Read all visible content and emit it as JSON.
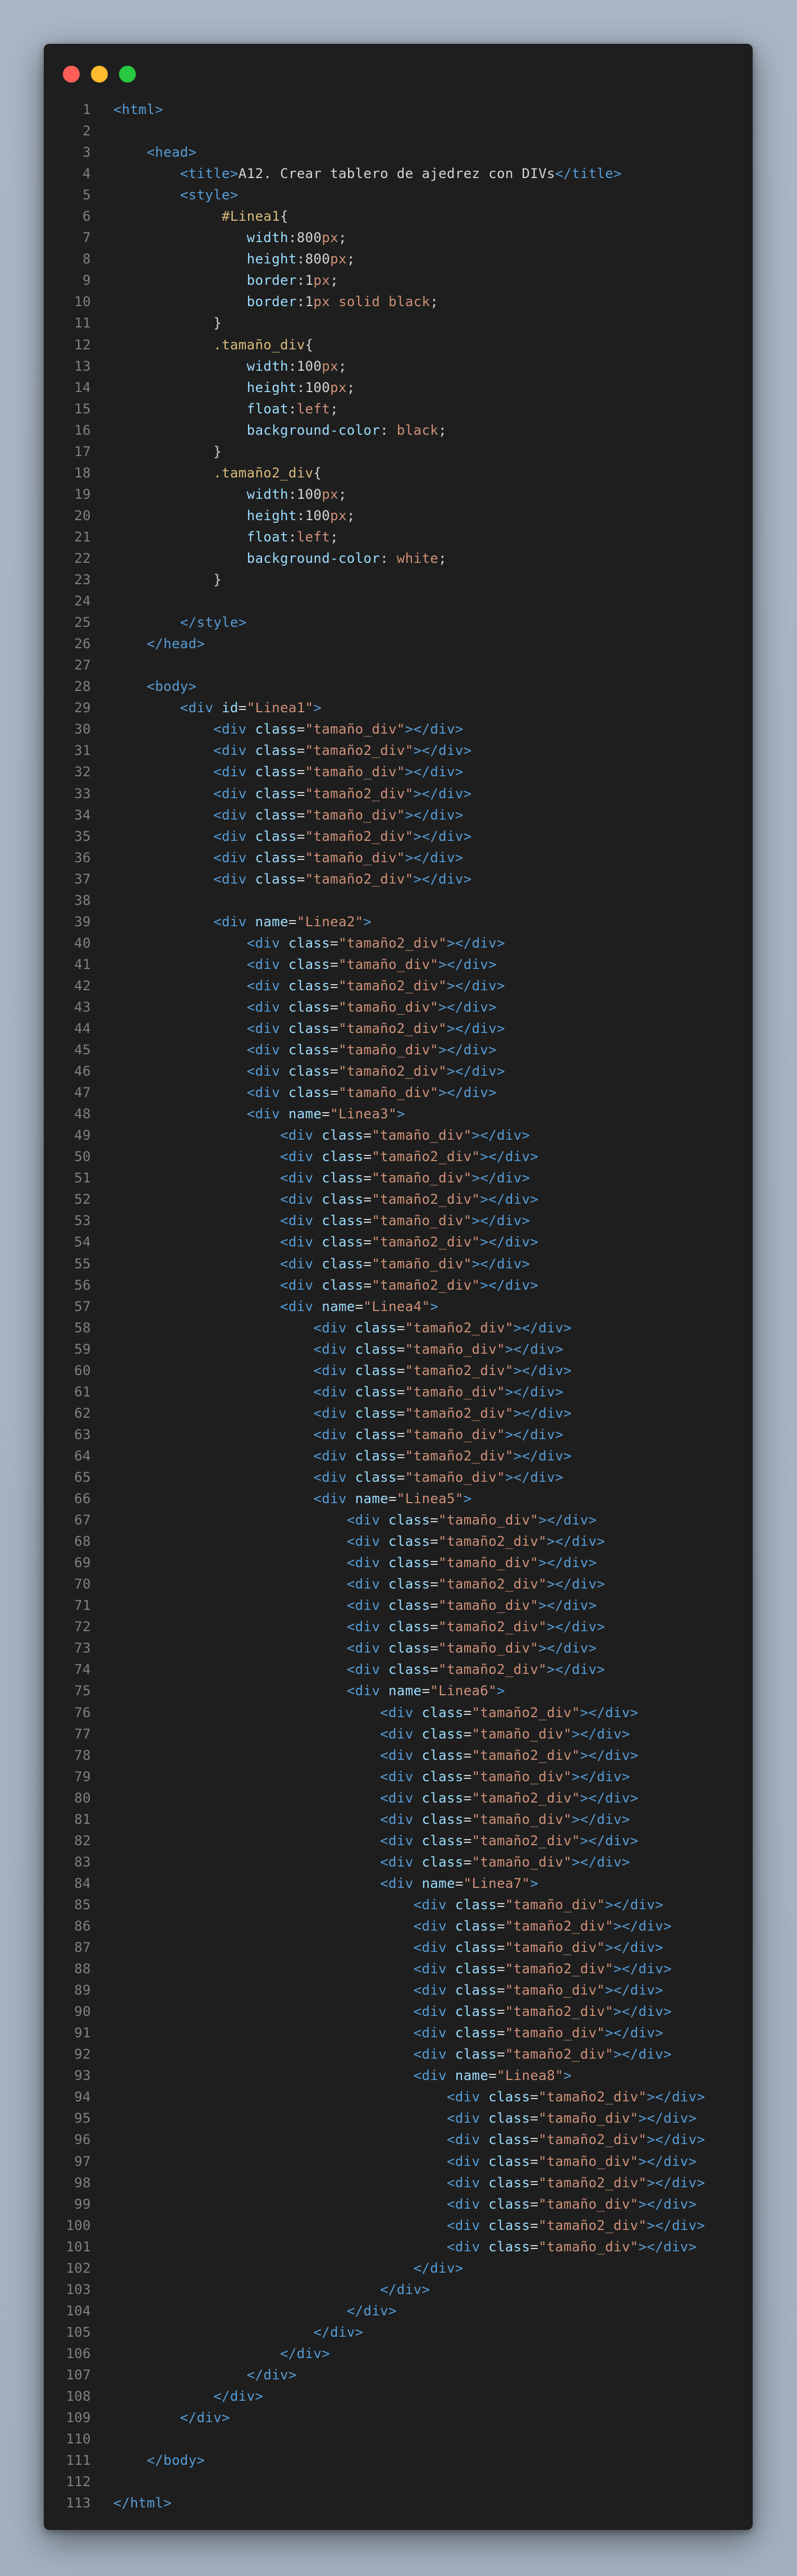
{
  "window": {
    "controls": [
      "close",
      "minimize",
      "maximize"
    ]
  },
  "colors": {
    "background": "#a9b6c4",
    "editor": "#1e1e1e",
    "close": "#ff5f57",
    "minimize": "#febc2e",
    "maximize": "#28c840",
    "tag": "#569cd6",
    "attr": "#9cdcfe",
    "string": "#ce9178",
    "selector": "#d7ba7d",
    "text": "#d4d4d4",
    "line_number": "#808080"
  },
  "code_lines": [
    "<html>",
    "",
    "    <head>",
    "        <title>A12. Crear tablero de ajedrez con DIVs</title>",
    "        <style>",
    "             #Linea1{",
    "                width:800px;",
    "                height:800px;",
    "                border:1px;",
    "                border:1px solid black;",
    "            }",
    "            .tamaño_div{",
    "                width:100px;",
    "                height:100px;",
    "                float:left;",
    "                background-color: black;",
    "            }",
    "            .tamaño2_div{",
    "                width:100px;",
    "                height:100px;",
    "                float:left;",
    "                background-color: white;",
    "            }",
    "",
    "        </style>",
    "    </head>",
    "",
    "    <body>",
    "        <div id=\"Linea1\">",
    "            <div class=\"tamaño_div\"></div>",
    "            <div class=\"tamaño2_div\"></div>",
    "            <div class=\"tamaño_div\"></div>",
    "            <div class=\"tamaño2_div\"></div>",
    "            <div class=\"tamaño_div\"></div>",
    "            <div class=\"tamaño2_div\"></div>",
    "            <div class=\"tamaño_div\"></div>",
    "            <div class=\"tamaño2_div\"></div>",
    "",
    "            <div name=\"Linea2\">",
    "                <div class=\"tamaño2_div\"></div>",
    "                <div class=\"tamaño_div\"></div>",
    "                <div class=\"tamaño2_div\"></div>",
    "                <div class=\"tamaño_div\"></div>",
    "                <div class=\"tamaño2_div\"></div>",
    "                <div class=\"tamaño_div\"></div>",
    "                <div class=\"tamaño2_div\"></div>",
    "                <div class=\"tamaño_div\"></div>",
    "                <div name=\"Linea3\">",
    "                    <div class=\"tamaño_div\"></div>",
    "                    <div class=\"tamaño2_div\"></div>",
    "                    <div class=\"tamaño_div\"></div>",
    "                    <div class=\"tamaño2_div\"></div>",
    "                    <div class=\"tamaño_div\"></div>",
    "                    <div class=\"tamaño2_div\"></div>",
    "                    <div class=\"tamaño_div\"></div>",
    "                    <div class=\"tamaño2_div\"></div>",
    "                    <div name=\"Linea4\">",
    "                        <div class=\"tamaño2_div\"></div>",
    "                        <div class=\"tamaño_div\"></div>",
    "                        <div class=\"tamaño2_div\"></div>",
    "                        <div class=\"tamaño_div\"></div>",
    "                        <div class=\"tamaño2_div\"></div>",
    "                        <div class=\"tamaño_div\"></div>",
    "                        <div class=\"tamaño2_div\"></div>",
    "                        <div class=\"tamaño_div\"></div>",
    "                        <div name=\"Linea5\">",
    "                            <div class=\"tamaño_div\"></div>",
    "                            <div class=\"tamaño2_div\"></div>",
    "                            <div class=\"tamaño_div\"></div>",
    "                            <div class=\"tamaño2_div\"></div>",
    "                            <div class=\"tamaño_div\"></div>",
    "                            <div class=\"tamaño2_div\"></div>",
    "                            <div class=\"tamaño_div\"></div>",
    "                            <div class=\"tamaño2_div\"></div>",
    "                            <div name=\"Linea6\">",
    "                                <div class=\"tamaño2_div\"></div>",
    "                                <div class=\"tamaño_div\"></div>",
    "                                <div class=\"tamaño2_div\"></div>",
    "                                <div class=\"tamaño_div\"></div>",
    "                                <div class=\"tamaño2_div\"></div>",
    "                                <div class=\"tamaño_div\"></div>",
    "                                <div class=\"tamaño2_div\"></div>",
    "                                <div class=\"tamaño_div\"></div>",
    "                                <div name=\"Linea7\">",
    "                                    <div class=\"tamaño_div\"></div>",
    "                                    <div class=\"tamaño2_div\"></div>",
    "                                    <div class=\"tamaño_div\"></div>",
    "                                    <div class=\"tamaño2_div\"></div>",
    "                                    <div class=\"tamaño_div\"></div>",
    "                                    <div class=\"tamaño2_div\"></div>",
    "                                    <div class=\"tamaño_div\"></div>",
    "                                    <div class=\"tamaño2_div\"></div>",
    "                                    <div name=\"Linea8\">",
    "                                        <div class=\"tamaño2_div\"></div>",
    "                                        <div class=\"tamaño_div\"></div>",
    "                                        <div class=\"tamaño2_div\"></div>",
    "                                        <div class=\"tamaño_div\"></div>",
    "                                        <div class=\"tamaño2_div\"></div>",
    "                                        <div class=\"tamaño_div\"></div>",
    "                                        <div class=\"tamaño2_div\"></div>",
    "                                        <div class=\"tamaño_div\"></div>",
    "                                    </div>",
    "                                </div>",
    "                            </div>",
    "                        </div>",
    "                    </div>",
    "                </div>",
    "            </div>",
    "        </div>",
    "",
    "    </body>",
    "",
    "</html>"
  ]
}
